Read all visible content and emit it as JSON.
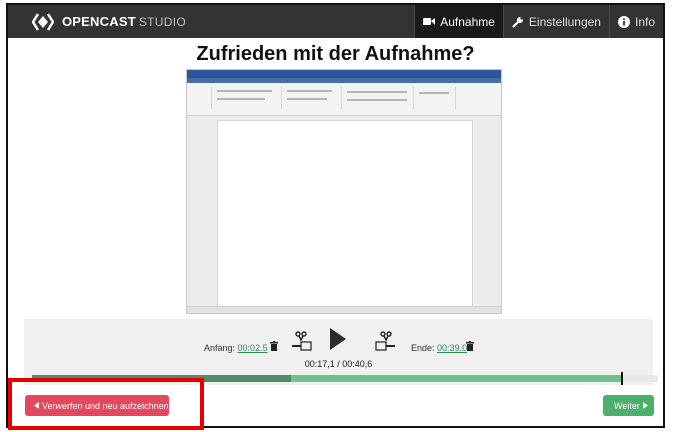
{
  "app": {
    "brand": "OPENCAST",
    "brand_sub": "STUDIO"
  },
  "nav": [
    {
      "label": "Aufnahme",
      "icon": "video-camera-icon",
      "active": true
    },
    {
      "label": "Einstellungen",
      "icon": "wrench-icon",
      "active": false
    },
    {
      "label": "Info",
      "icon": "info-icon",
      "active": false
    }
  ],
  "page": {
    "title": "Zufrieden mit der Aufnahme?"
  },
  "cut": {
    "start_label": "Anfang:",
    "start_value": "00:02.5",
    "end_label": "Ende:",
    "end_value": "00:39.0",
    "time": "00:17,1 / 00:40,6"
  },
  "timeline": {
    "played_fraction": 0.417,
    "end_fraction": 0.942
  },
  "actions": {
    "discard": "Verwerfen und neu aufzeichnen",
    "next": "Weiter"
  },
  "colors": {
    "topbar": "#333333",
    "discard": "#e3485e",
    "next": "#4caf6b",
    "link": "#2e8b57",
    "highlight": "#e60000"
  }
}
